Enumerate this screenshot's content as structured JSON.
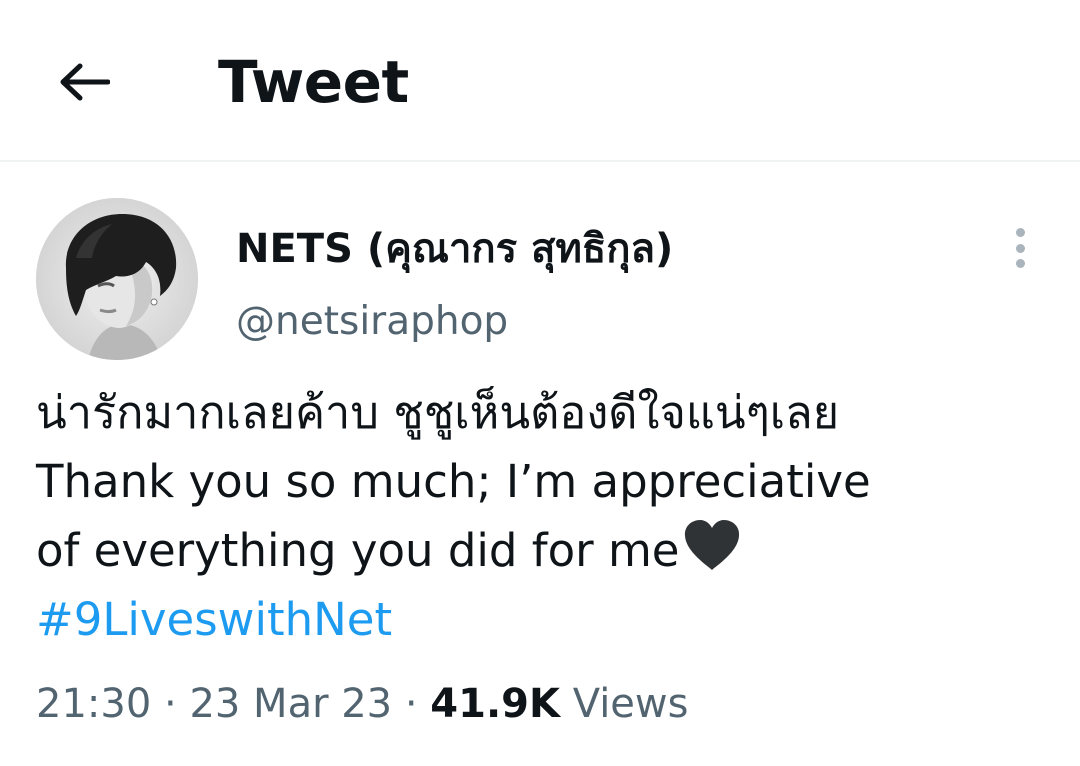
{
  "header": {
    "title": "Tweet",
    "back_icon": "arrow-left-icon"
  },
  "tweet": {
    "author": {
      "display_name": "NETS (คุณากร สุทธิกุล)",
      "handle": "@netsiraphop",
      "avatar_icon": "profile-avatar"
    },
    "more_icon": "more-vertical-icon",
    "text_lines": [
      "น่ารักมากเลยค้าบ ชูชูเห็นต้องดีใจแน่ๆเลย",
      "Thank you so much; I’m appreciative",
      "of everything you did for me"
    ],
    "emoji": "black-heart-icon",
    "hashtag": "#9LiveswithNet",
    "time": "21:30",
    "separator": "·",
    "date": "23 Mar 23",
    "views_count": "41.9K",
    "views_label": "Views"
  },
  "colors": {
    "text": "#0f1419",
    "secondary": "#536471",
    "link": "#1d9bf0",
    "divider": "#eff3f4"
  }
}
